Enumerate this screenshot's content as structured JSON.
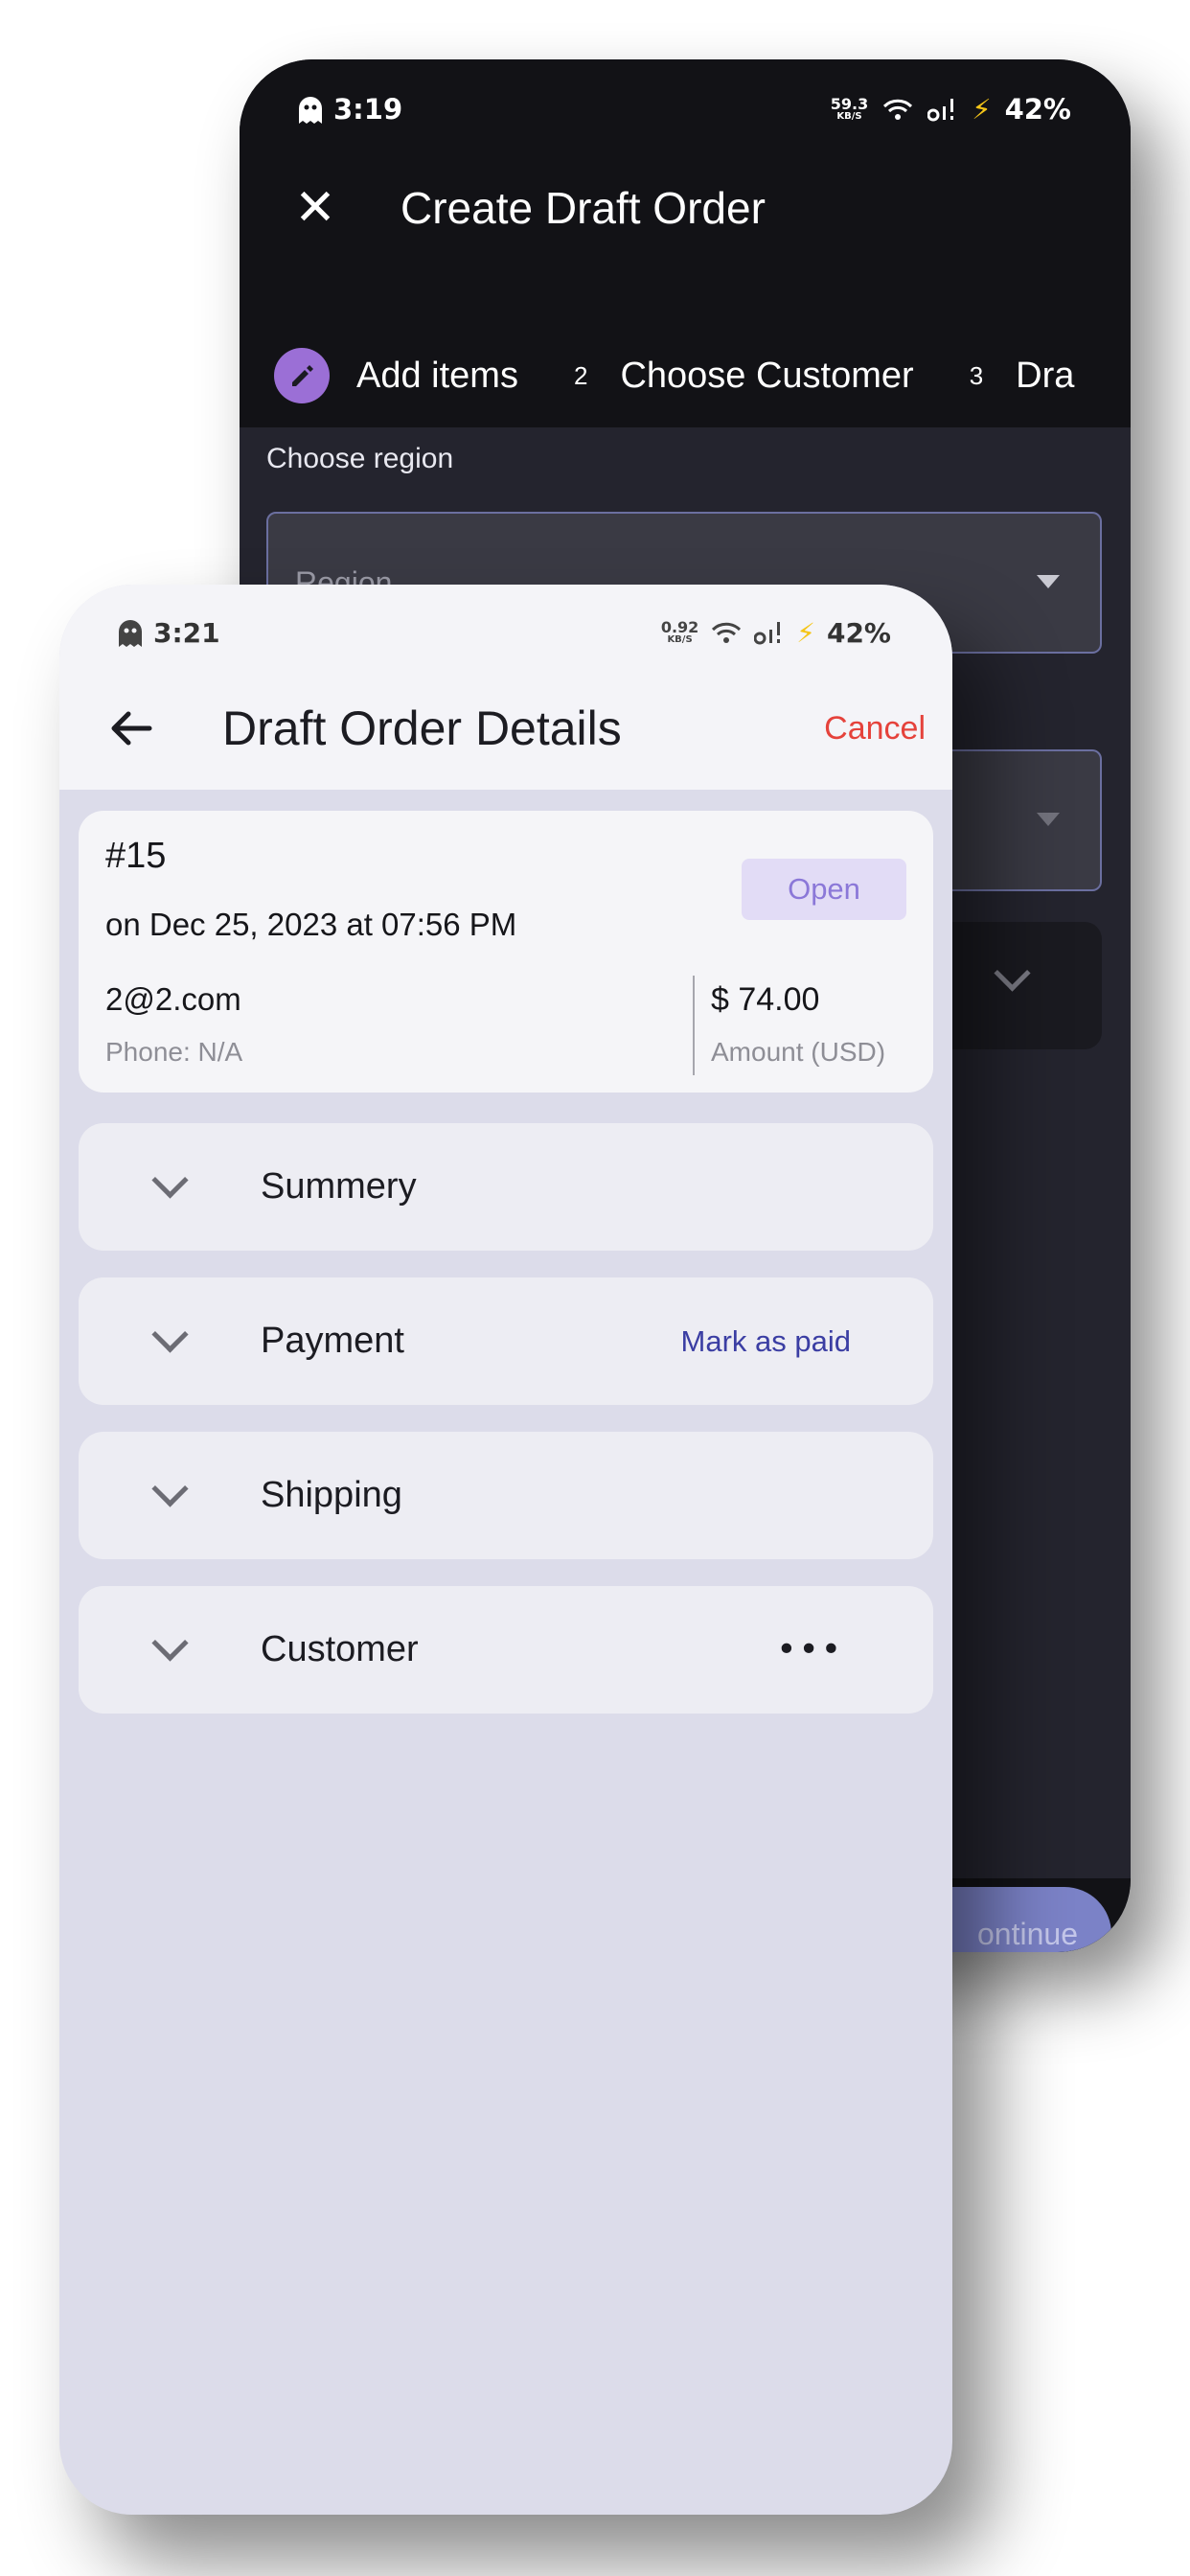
{
  "back_screen": {
    "status_bar": {
      "time": "3:19",
      "net_speed": "59.3",
      "net_speed_unit": "KB/S",
      "battery": "42%"
    },
    "title": "Create Draft Order",
    "steps": [
      {
        "label": "Add items",
        "icon": "pencil-icon"
      },
      {
        "number": "2",
        "label": "Choose Customer"
      },
      {
        "number": "3",
        "label": "Dra"
      }
    ],
    "region_label": "Choose region",
    "region_placeholder": "Region",
    "continue_label": "ontinue",
    "accent_color": "#9b6fd6"
  },
  "front_screen": {
    "status_bar": {
      "time": "3:21",
      "net_speed": "0.92",
      "net_speed_unit": "KB/S",
      "battery": "42%"
    },
    "title": "Draft Order Details",
    "cancel_label": "Cancel",
    "order": {
      "id": "#15",
      "date": "on Dec 25, 2023 at 07:56 PM",
      "status": "Open",
      "email": "2@2.com",
      "phone": "Phone: N/A",
      "amount": "$ 74.00",
      "amount_label": "Amount (USD)"
    },
    "sections": [
      {
        "label": "Summery"
      },
      {
        "label": "Payment",
        "action": "Mark as paid"
      },
      {
        "label": "Shipping"
      },
      {
        "label": "Customer",
        "menu": "more-icon"
      }
    ],
    "colors": {
      "cancel": "#e5423b",
      "badge_text": "#8b78d8",
      "link": "#3b3ea3"
    }
  }
}
